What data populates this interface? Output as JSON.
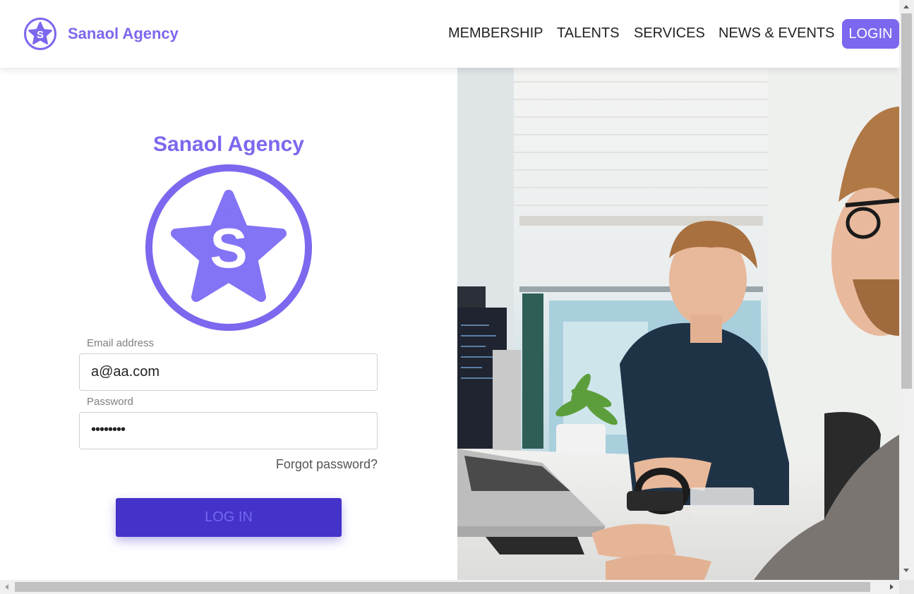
{
  "brand": {
    "name": "Sanaol Agency",
    "logo_letter": "S"
  },
  "nav": {
    "items": [
      {
        "label": "MEMBERSHIP"
      },
      {
        "label": "TALENTS"
      },
      {
        "label": "SERVICES"
      },
      {
        "label": "NEWS & EVENTS"
      }
    ],
    "login_label": "LOGIN"
  },
  "login_form": {
    "title": "Sanaol Agency",
    "logo_letter": "S",
    "email": {
      "label": "Email address",
      "value": "a@aa.com"
    },
    "password": {
      "label": "Password",
      "masked_value": "••••••••"
    },
    "forgot_label": "Forgot password?",
    "submit_label": "LOG IN"
  },
  "hero_image": {
    "icon": "office-photo"
  },
  "colors": {
    "accent": "#7b68ee",
    "button": "#4432c9",
    "button_text": "#7468f0"
  }
}
